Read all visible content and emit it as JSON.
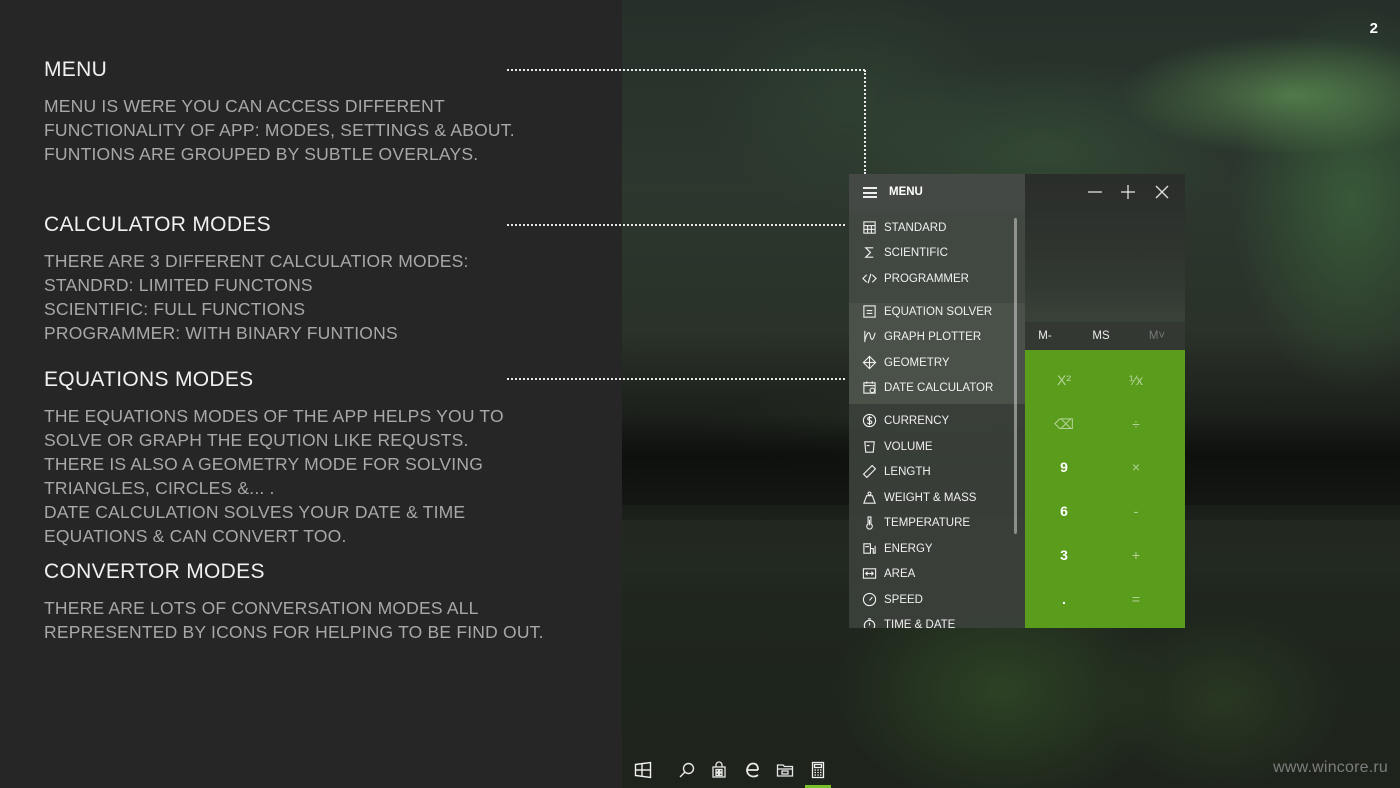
{
  "page_number": "2",
  "sections": [
    {
      "title": "MENU",
      "lines": [
        "MENU IS WERE YOU CAN ACCESS DIFFERENT",
        "FUNCTIONALITY OF APP: MODES, SETTINGS & ABOUT.",
        "FUNTIONS ARE GROUPED BY SUBTLE OVERLAYS."
      ]
    },
    {
      "title": "CALCULATOR MODES",
      "lines": [
        "THERE ARE 3 DIFFERENT CALCULATIOR MODES:",
        "STANDRD: LIMITED FUNCTONS",
        "SCIENTIFIC: FULL FUNCTIONS",
        "PROGRAMMER: WITH BINARY FUNTIONS"
      ]
    },
    {
      "title": "EQUATIONS MODES",
      "lines": [
        "THE EQUATIONS MODES OF THE APP HELPS YOU TO",
        "SOLVE OR GRAPH THE EQUTION LIKE REQUSTS.",
        "THERE IS ALSO A GEOMETRY MODE FOR SOLVING",
        "TRIANGLES, CIRCLES &... .",
        "DATE CALCULATION SOLVES YOUR DATE & TIME",
        "EQUATIONS & CAN CONVERT TOO."
      ]
    },
    {
      "title": "CONVERTOR MODES",
      "lines": [
        "THERE ARE LOTS OF CONVERSATION MODES ALL",
        "REPRESENTED BY ICONS FOR HELPING TO BE FIND OUT."
      ]
    }
  ],
  "calculator": {
    "menu_title": "MENU",
    "menu_items": [
      {
        "label": "STANDARD",
        "icon": "standard-icon"
      },
      {
        "label": "SCIENTIFIC",
        "icon": "sigma-icon"
      },
      {
        "label": "PROGRAMMER",
        "icon": "code-icon"
      },
      {
        "label": "EQUATION SOLVER",
        "icon": "equation-icon"
      },
      {
        "label": "GRAPH PLOTTER",
        "icon": "graph-icon"
      },
      {
        "label": "GEOMETRY",
        "icon": "geometry-icon"
      },
      {
        "label": "DATE CALCULATOR",
        "icon": "calendar-icon"
      },
      {
        "label": "CURRENCY",
        "icon": "currency-icon"
      },
      {
        "label": "VOLUME",
        "icon": "volume-icon"
      },
      {
        "label": "LENGTH",
        "icon": "ruler-icon"
      },
      {
        "label": "WEIGHT & MASS",
        "icon": "weight-icon"
      },
      {
        "label": "TEMPERATURE",
        "icon": "thermometer-icon"
      },
      {
        "label": "ENERGY",
        "icon": "energy-icon"
      },
      {
        "label": "AREA",
        "icon": "area-icon"
      },
      {
        "label": "SPEED",
        "icon": "speedometer-icon"
      },
      {
        "label": "TIME & DATE",
        "icon": "stopwatch-icon"
      }
    ],
    "memory_buttons": [
      "M-",
      "MS",
      "M˅"
    ],
    "keys": [
      [
        "X²",
        "¹⁄x"
      ],
      [
        "⌫",
        "÷"
      ],
      [
        "9",
        "×"
      ],
      [
        "6",
        "-"
      ],
      [
        "3",
        "+"
      ],
      [
        ".",
        "="
      ]
    ],
    "colors": {
      "accent": "#5a9c1b",
      "menu_background": "#3a403a"
    }
  },
  "taskbar": {
    "icons": [
      "windows-start-icon",
      "search-icon",
      "store-icon",
      "edge-icon",
      "file-explorer-icon",
      "calculator-icon"
    ],
    "active_color": "#78c02a"
  },
  "watermark": "www.wincore.ru"
}
